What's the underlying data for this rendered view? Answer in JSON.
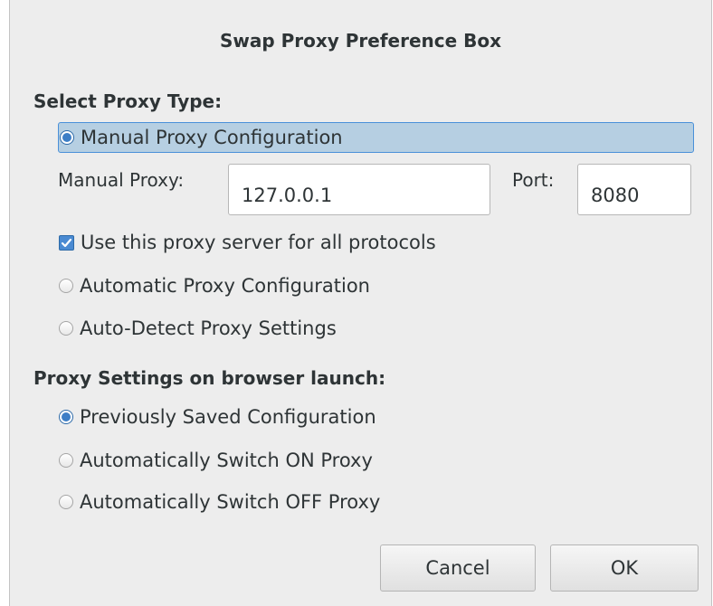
{
  "dialog": {
    "title": "Swap Proxy Preference Box"
  },
  "proxy_type": {
    "header": "Select Proxy Type:",
    "manual": {
      "label": "Manual Proxy Configuration",
      "selected": true
    },
    "manual_proxy_label": "Manual Proxy:",
    "manual_proxy_value": "127.0.0.1",
    "port_label": "Port:",
    "port_value": "8080",
    "all_protocols": {
      "label": "Use this proxy server for all protocols",
      "checked": true
    },
    "automatic": {
      "label": "Automatic Proxy Configuration",
      "selected": false
    },
    "auto_detect": {
      "label": "Auto-Detect Proxy Settings",
      "selected": false
    }
  },
  "launch_settings": {
    "header": "Proxy Settings on browser launch:",
    "previously_saved": {
      "label": "Previously Saved Configuration",
      "selected": true
    },
    "switch_on": {
      "label": "Automatically Switch ON Proxy",
      "selected": false
    },
    "switch_off": {
      "label": "Automatically Switch OFF Proxy",
      "selected": false
    }
  },
  "buttons": {
    "cancel": "Cancel",
    "ok": "OK"
  },
  "colors": {
    "accent": "#4a8ad2",
    "selection": "#b6cfe2",
    "background": "#ededed"
  }
}
